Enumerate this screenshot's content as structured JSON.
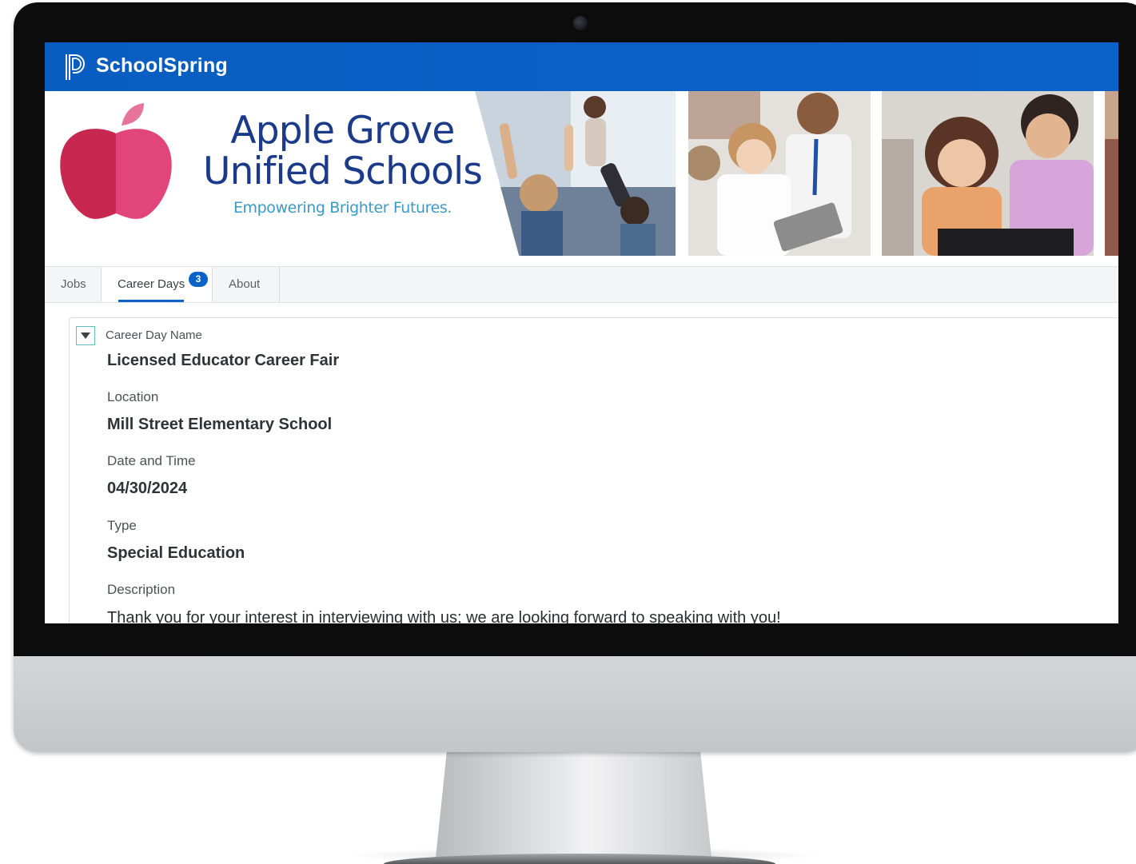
{
  "app": {
    "brand": "SchoolSpring"
  },
  "banner": {
    "school_name_line1": "Apple Grove",
    "school_name_line2": "Unified Schools",
    "tagline": "Empowering Brighter Futures."
  },
  "tabs": [
    {
      "label": "Jobs",
      "active": false
    },
    {
      "label": "Career Days",
      "active": true,
      "badge": "3"
    },
    {
      "label": "About",
      "active": false
    }
  ],
  "career_day": {
    "name_label": "Career Day Name",
    "name": "Licensed Educator Career Fair",
    "location_label": "Location",
    "location": "Mill Street Elementary School",
    "datetime_label": "Date and Time",
    "datetime": "04/30/2024",
    "type_label": "Type",
    "type": "Special Education",
    "description_label": "Description",
    "description": "Thank you for your interest in interviewing with us; we are looking forward to speaking with you!"
  },
  "colors": {
    "header_blue": "#0b62c9",
    "school_navy": "#1b3a8a",
    "tagline_blue": "#3a9ac9",
    "apple_red": "#c8284f",
    "apple_pink": "#e2457a"
  },
  "icons": {
    "logo": "schoolspring-logo-icon",
    "toggle": "caret-down-icon"
  }
}
